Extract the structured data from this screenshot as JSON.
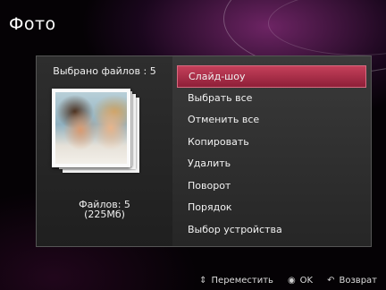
{
  "header": {
    "title": "Фото"
  },
  "left_pane": {
    "selected_text": "Выбрано файлов : 5",
    "files_count": "Файлов: 5",
    "files_size": "(225Мб)"
  },
  "menu": {
    "active_index": 0,
    "items": [
      {
        "label": "Слайд-шоу"
      },
      {
        "label": "Выбрать все"
      },
      {
        "label": "Отменить все"
      },
      {
        "label": "Копировать"
      },
      {
        "label": "Удалить"
      },
      {
        "label": "Поворот"
      },
      {
        "label": "Порядок"
      },
      {
        "label": "Выбор устройства"
      }
    ]
  },
  "footer": {
    "move_label": "Переместить",
    "ok_label": "OK",
    "back_label": "Возврат"
  },
  "colors": {
    "accent": "#b0304c",
    "panel": "#2f2f2f"
  }
}
